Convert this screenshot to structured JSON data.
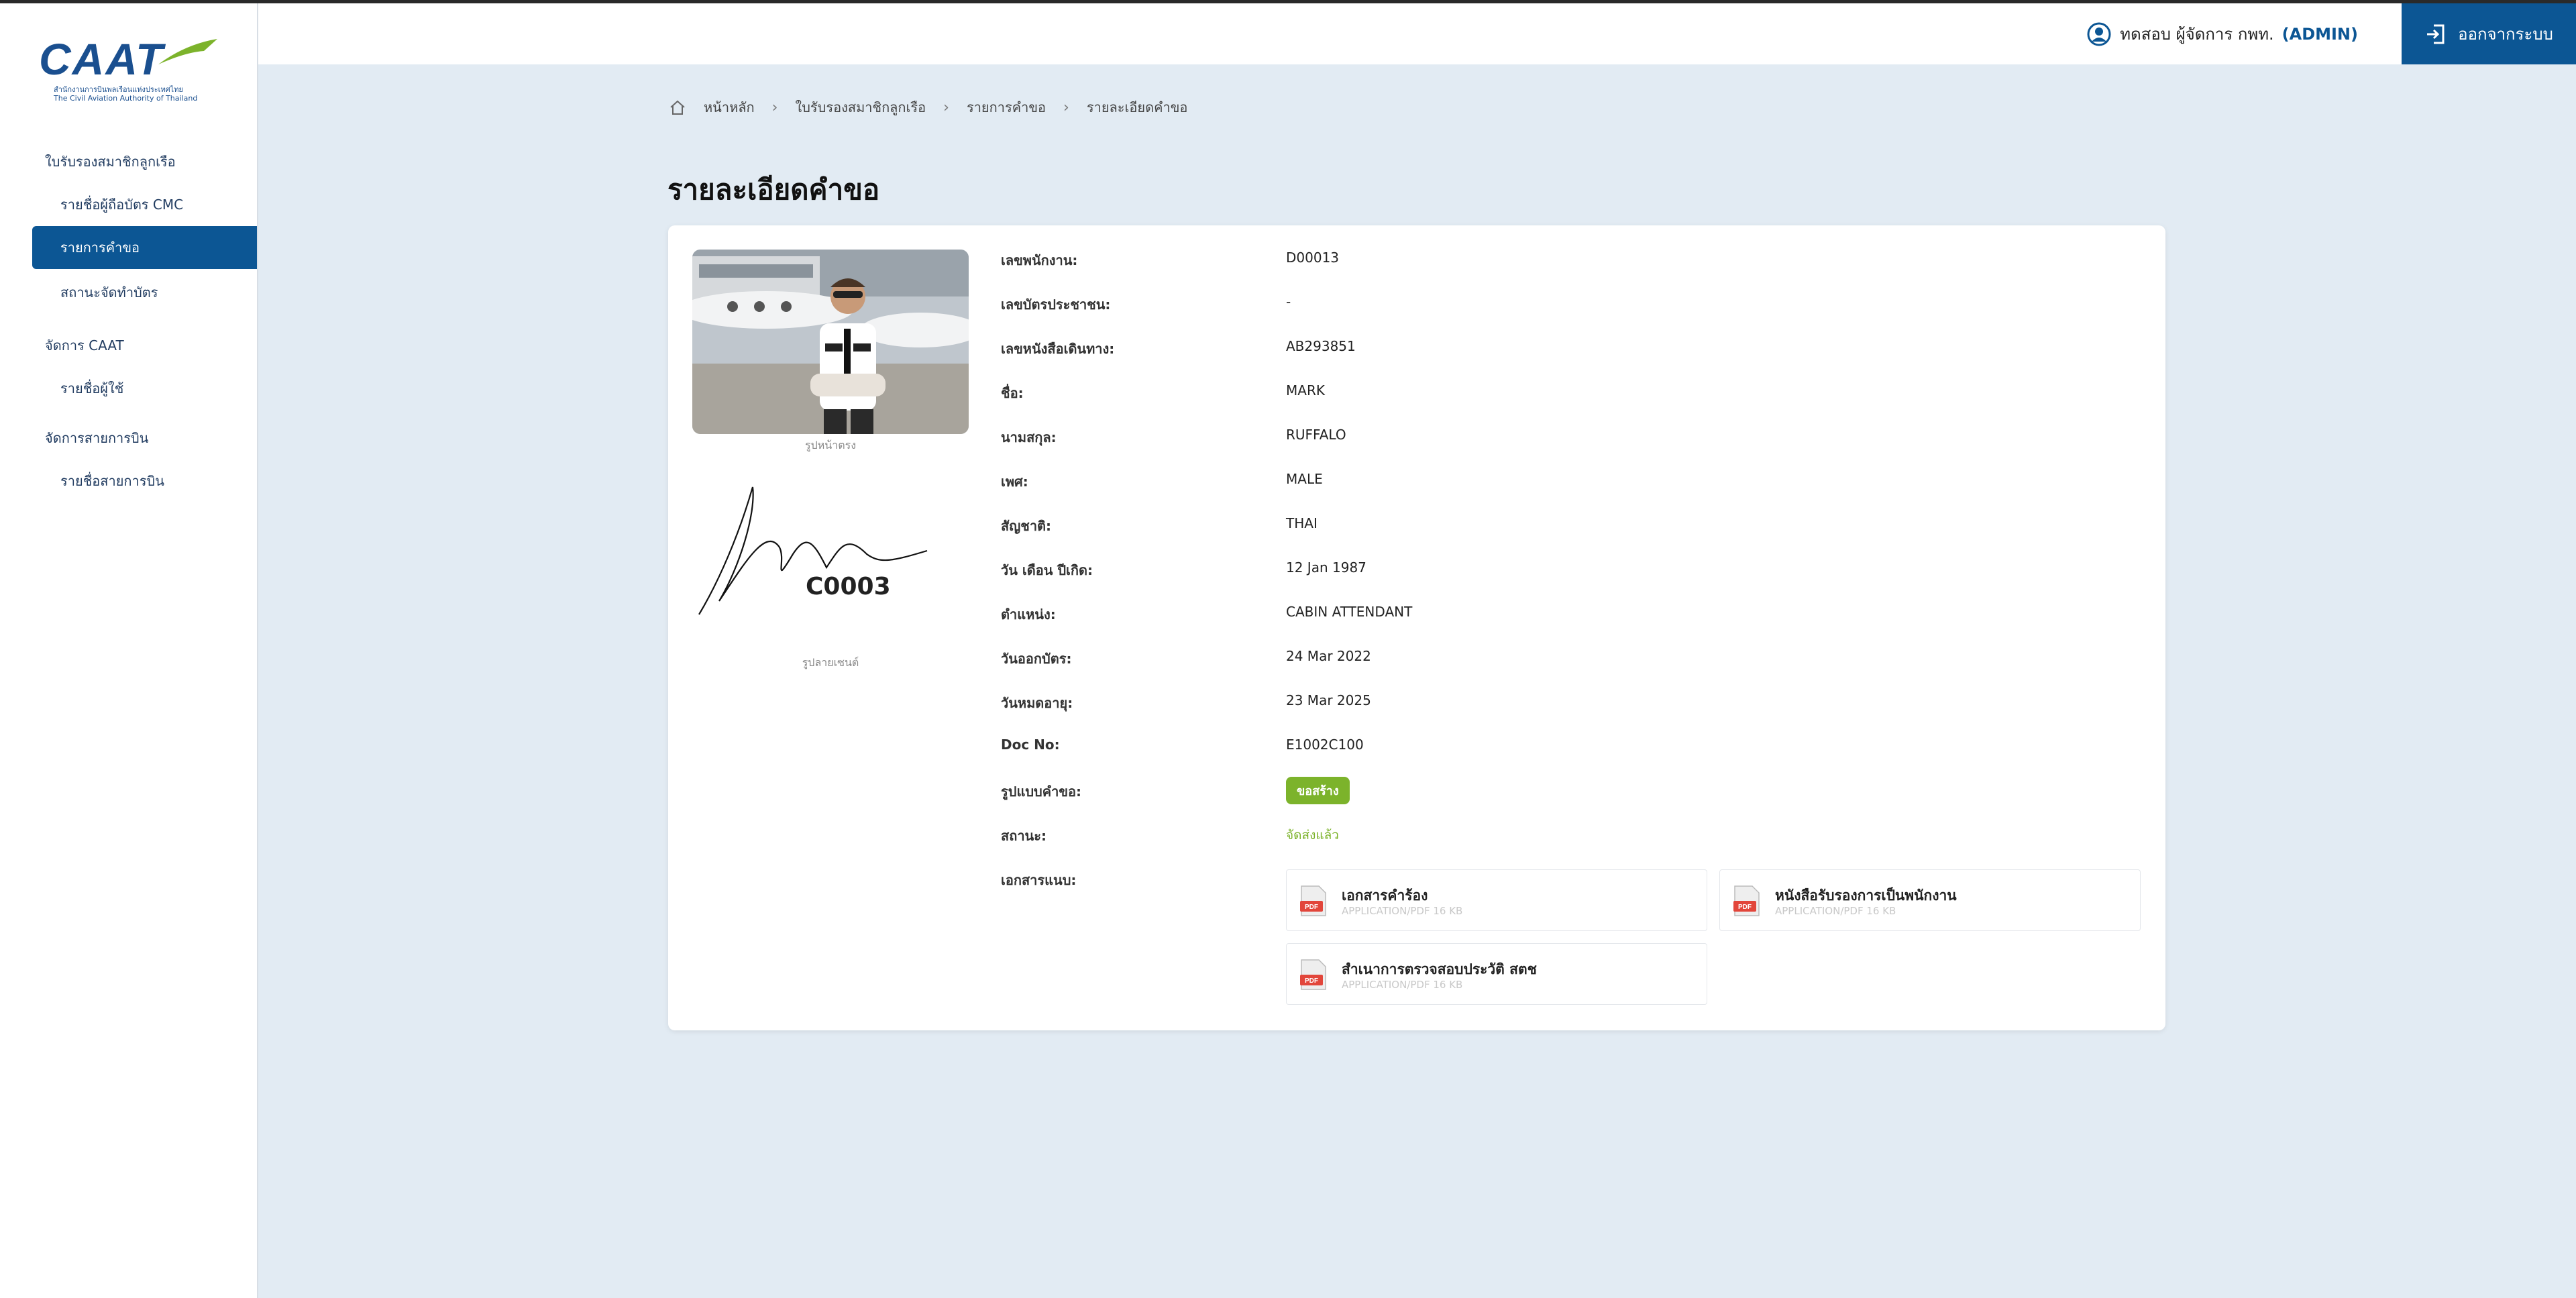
{
  "brand": {
    "logo_text": "CAAT",
    "logo_sub_th": "สำนักงานการบินพลเรือนแห่งประเทศไทย",
    "logo_sub_en": "The Civil Aviation Authority of Thailand",
    "colors": {
      "primary": "#0c5694",
      "accent_green": "#7cb32b",
      "page_bg": "#e2ebf3"
    }
  },
  "sidebar": {
    "sections": [
      {
        "label": "ใบรับรองสมาชิกลูกเรือ",
        "items": [
          {
            "label": "รายชื่อผู้ถือบัตร CMC",
            "active": false
          },
          {
            "label": "รายการคำขอ",
            "active": true
          },
          {
            "label": "สถานะจัดทำบัตร",
            "active": false
          }
        ]
      },
      {
        "label": "จัดการ CAAT",
        "items": [
          {
            "label": "รายชื่อผู้ใช้",
            "active": false
          }
        ]
      },
      {
        "label": "จัดการสายการบิน",
        "items": [
          {
            "label": "รายชื่อสายการบิน",
            "active": false
          }
        ]
      }
    ]
  },
  "topbar": {
    "user_icon": "user-circle-icon",
    "user_name": "ทดสอบ ผู้จัดการ กพท.",
    "user_role": "(ADMIN)",
    "logout_icon": "logout-icon",
    "logout_label": "ออกจากระบบ"
  },
  "breadcrumb": {
    "home_icon": "home-icon",
    "items": [
      "หน้าหลัก",
      "ใบรับรองสมาชิกลูกเรือ",
      "รายการคำขอ",
      "รายละเอียดคำขอ"
    ]
  },
  "page_title": "รายละเอียดคำขอ",
  "profile": {
    "photo_caption": "รูปหน้าตรง",
    "signature_code": "C0003",
    "signature_caption": "รูปลายเซนต์"
  },
  "details": [
    {
      "label": "เลขพนักงาน:",
      "value": "D00013"
    },
    {
      "label": "เลขบัตรประชาชน:",
      "value": "-"
    },
    {
      "label": "เลขหนังสือเดินทาง:",
      "value": "AB293851"
    },
    {
      "label": "ชื่อ:",
      "value": "MARK"
    },
    {
      "label": "นามสกุล:",
      "value": "RUFFALO"
    },
    {
      "label": "เพศ:",
      "value": "MALE"
    },
    {
      "label": "สัญชาติ:",
      "value": "THAI"
    },
    {
      "label": "วัน เดือน ปีเกิด:",
      "value": "12 Jan 1987"
    },
    {
      "label": "ตำแหน่ง:",
      "value": "CABIN ATTENDANT"
    },
    {
      "label": "วันออกบัตร:",
      "value": "24 Mar 2022"
    },
    {
      "label": "วันหมดอายุ:",
      "value": "23 Mar 2025"
    },
    {
      "label": "Doc No:",
      "value": "E1002C100"
    }
  ],
  "request_type": {
    "label": "รูปแบบคำขอ:",
    "badge": "ขอสร้าง"
  },
  "status": {
    "label": "สถานะ:",
    "value": "จัดส่งแล้ว"
  },
  "attachments": {
    "label": "เอกสารแนบ:",
    "files": [
      {
        "name": "เอกสารคำร้อง",
        "meta": "APPLICATION/PDF 16 KB",
        "icon": "pdf-icon"
      },
      {
        "name": "หนังสือรับรองการเป็นพนักงาน",
        "meta": "APPLICATION/PDF 16 KB",
        "icon": "pdf-icon"
      },
      {
        "name": "สำเนาการตรวจสอบประวัติ สตช",
        "meta": "APPLICATION/PDF 16 KB",
        "icon": "pdf-icon"
      }
    ]
  }
}
